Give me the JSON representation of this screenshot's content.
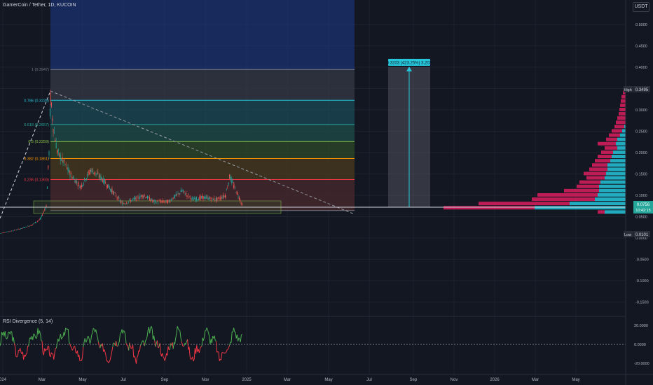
{
  "header": {
    "symbol_title": "GamerCoin / Tether, 1D, KUCOIN",
    "currency_button": "USDT"
  },
  "price_scale": [
    "0.5000",
    "0.4500",
    "0.4000",
    "0.3500",
    "0.3000",
    "0.2500",
    "0.2000",
    "0.1500",
    "0.1000",
    "0.0500",
    "0.0000",
    "-0.0500",
    "-0.1000",
    "-0.1500"
  ],
  "price_markers": {
    "high": {
      "label": "High",
      "value": "0.3495"
    },
    "current": {
      "value": "0.0756",
      "countdown": "10:42:15"
    },
    "low": {
      "label": "Low",
      "value": "0.0101"
    }
  },
  "fib_levels": [
    {
      "label": "1 (0.3947)",
      "value": 0.3947,
      "color": "#787b86"
    },
    {
      "label": "0.786 (0.3225)",
      "value": 0.3225,
      "color": "#26c6da"
    },
    {
      "label": "0.618 (0.2657)",
      "value": 0.2657,
      "color": "#26a69a"
    },
    {
      "label": "0.5 (0.2259)",
      "value": 0.2259,
      "color": "#8bc34a"
    },
    {
      "label": "0.382 (0.1861)",
      "value": 0.1861,
      "color": "#ff9800"
    },
    {
      "label": "0.236 (0.1369)",
      "value": 0.1369,
      "color": "#f23645"
    }
  ],
  "measure_label": "0.3203 (423.25%) 3,203",
  "time_axis": [
    "024",
    "Mar",
    "May",
    "Jul",
    "Sep",
    "Nov",
    "2025",
    "Mar",
    "May",
    "Jul",
    "Sep",
    "Nov",
    "2026",
    "Mar",
    "May"
  ],
  "rsi": {
    "title": "RSI Divergence (5, 14)",
    "scale": [
      "20.0000",
      "0.0000",
      "-20.0000"
    ]
  },
  "colors": {
    "background": "#131722",
    "up": "#26a69a",
    "down": "#ef5350",
    "rsi_up": "#4caf50",
    "rsi_down": "#f23645",
    "volume_profile_up": "#26c6da",
    "volume_profile_down": "#e91e63",
    "projection_box": "#1c3a8a"
  },
  "chart_data": {
    "type": "line",
    "title": "GamerCoin / Tether, 1D, KUCOIN",
    "x_label": "",
    "y_label": "",
    "x": [
      "2024-01",
      "2024-02",
      "2024-02-20",
      "2024-03-01",
      "2024-03-05",
      "2024-03-15",
      "2024-04-01",
      "2024-05-01",
      "2024-05-15",
      "2024-06-01",
      "2024-07-01",
      "2024-08-01",
      "2024-09-01",
      "2024-10-01",
      "2024-11-01",
      "2024-11-20",
      "2024-12-01",
      "2024-12-10"
    ],
    "series": [
      {
        "name": "GamerCoin / Tether",
        "values": [
          0.01,
          0.025,
          0.04,
          0.06,
          0.34,
          0.24,
          0.17,
          0.15,
          0.12,
          0.11,
          0.07,
          0.065,
          0.075,
          0.07,
          0.09,
          0.145,
          0.1,
          0.0756
        ]
      }
    ],
    "ylim": [
      -0.17,
      0.55
    ],
    "grid": true,
    "rsi": {
      "name": "RSI Divergence",
      "ylim": [
        -30,
        30
      ]
    }
  }
}
